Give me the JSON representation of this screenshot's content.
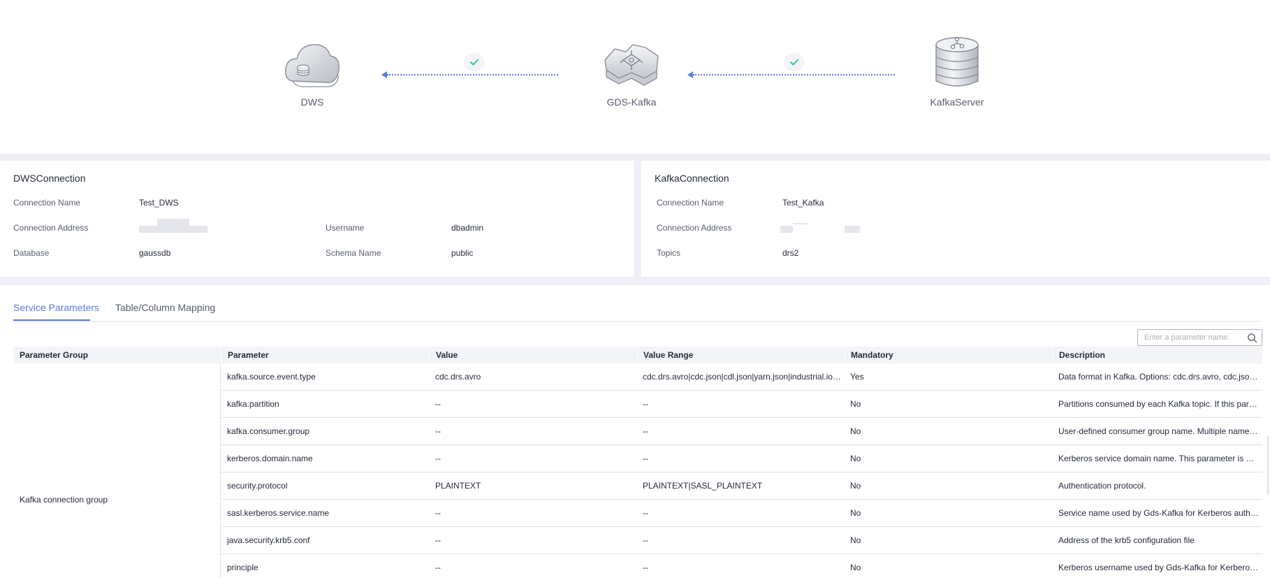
{
  "topology": {
    "nodes": {
      "dws": {
        "label": "DWS",
        "icon": "cloud-database-icon"
      },
      "gds_kafka": {
        "label": "GDS-Kafka",
        "icon": "gds-kafka-service-icon"
      },
      "kafka_server": {
        "label": "KafkaServer",
        "icon": "database-cylinder-icon"
      }
    },
    "links": [
      {
        "from": "GDS-Kafka",
        "to": "DWS",
        "status": "connected",
        "status_icon": "check-icon"
      },
      {
        "from": "KafkaServer",
        "to": "GDS-Kafka",
        "status": "connected",
        "status_icon": "check-icon"
      }
    ]
  },
  "dws_connection": {
    "title": "DWSConnection",
    "connection_name_label": "Connection Name",
    "connection_name": "Test_DWS",
    "connection_address_label": "Connection Address",
    "connection_address": "",
    "username_label": "Username",
    "username": "dbadmin",
    "database_label": "Database",
    "database": "gaussdb",
    "schema_name_label": "Schema Name",
    "schema_name": "public"
  },
  "kafka_connection": {
    "title": "KafkaConnection",
    "connection_name_label": "Connection Name",
    "connection_name": "Test_Kafka",
    "connection_address_label": "Connection Address",
    "connection_address": "",
    "topics_label": "Topics",
    "topics": "drs2"
  },
  "tabs": {
    "service_parameters": "Service Parameters",
    "table_column_mapping": "Table/Column Mapping",
    "active": "service_parameters"
  },
  "search": {
    "placeholder": "Enter a parameter name."
  },
  "table": {
    "headers": {
      "group": "Parameter Group",
      "parameter": "Parameter",
      "value": "Value",
      "value_range": "Value Range",
      "mandatory": "Mandatory",
      "description": "Description"
    },
    "group": "Kafka connection group",
    "rows": [
      {
        "parameter": "kafka.source.event.type",
        "value": "cdc.drs.avro",
        "range": "cdc.drs.avro|cdc.json|cdl.json|yarn.json|industrial.iot.json",
        "mandatory": "Yes",
        "description": "Data format in Kafka. Options: cdc.drs.avro, cdc.json, cd..."
      },
      {
        "parameter": "kafka.partition",
        "value": "--",
        "range": "--",
        "mandatory": "No",
        "description": "Partitions consumed by each Kafka topic. If this paramet..."
      },
      {
        "parameter": "kafka.consumer.group",
        "value": "--",
        "range": "--",
        "mandatory": "No",
        "description": "User-defined consumer group name. Multiple names ar..."
      },
      {
        "parameter": "kerberos.domain.name",
        "value": "--",
        "range": "--",
        "mandatory": "No",
        "description": "Kerberos service domain name. This parameter is mand..."
      },
      {
        "parameter": "security.protocol",
        "value": "PLAINTEXT",
        "range": "PLAINTEXT|SASL_PLAINTEXT",
        "mandatory": "No",
        "description": "Authentication protocol."
      },
      {
        "parameter": "sasl.kerberos.service.name",
        "value": "--",
        "range": "--",
        "mandatory": "No",
        "description": "Service name used by Gds-Kafka for Kerberos authenti..."
      },
      {
        "parameter": "java.security.krb5.conf",
        "value": "--",
        "range": "--",
        "mandatory": "No",
        "description": "Address of the krb5 configuration file"
      },
      {
        "parameter": "principle",
        "value": "--",
        "range": "--",
        "mandatory": "No",
        "description": "Kerberos username used by Gds-Kafka for Kerberos au..."
      }
    ]
  },
  "colors": {
    "accent": "#5e7ce0",
    "success": "#3ac295",
    "band": "#eef0f5",
    "header_bg": "#f2f4f7",
    "border": "#dfe1e6"
  }
}
